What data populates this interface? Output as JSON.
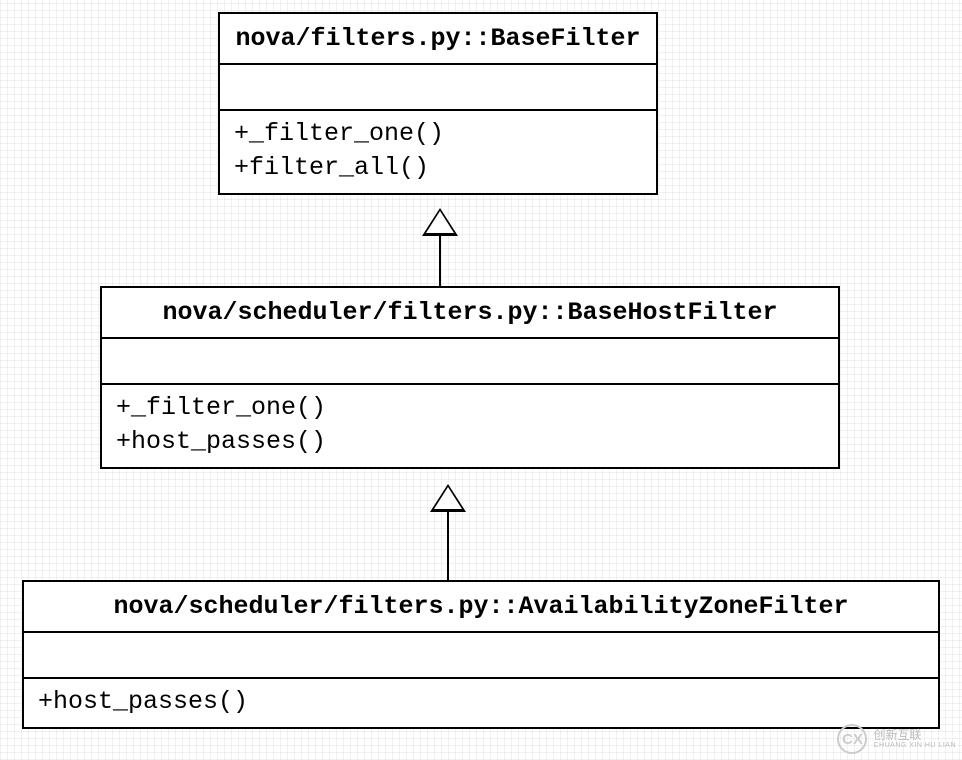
{
  "diagram": {
    "type": "uml-class-diagram",
    "classes": [
      {
        "id": "c1",
        "title": "nova/filters.py::BaseFilter",
        "operations": [
          "+_filter_one()",
          "+filter_all()"
        ]
      },
      {
        "id": "c2",
        "title": "nova/scheduler/filters.py::BaseHostFilter",
        "operations": [
          "+_filter_one()",
          "+host_passes()"
        ]
      },
      {
        "id": "c3",
        "title": "nova/scheduler/filters.py::AvailabilityZoneFilter",
        "operations": [
          "+host_passes()"
        ]
      }
    ],
    "inheritance": [
      {
        "child": "c2",
        "parent": "c1"
      },
      {
        "child": "c3",
        "parent": "c2"
      }
    ]
  },
  "watermark": {
    "logo": "CX",
    "line1": "创新互联",
    "line2": "CHUANG XIN HU LIAN"
  }
}
